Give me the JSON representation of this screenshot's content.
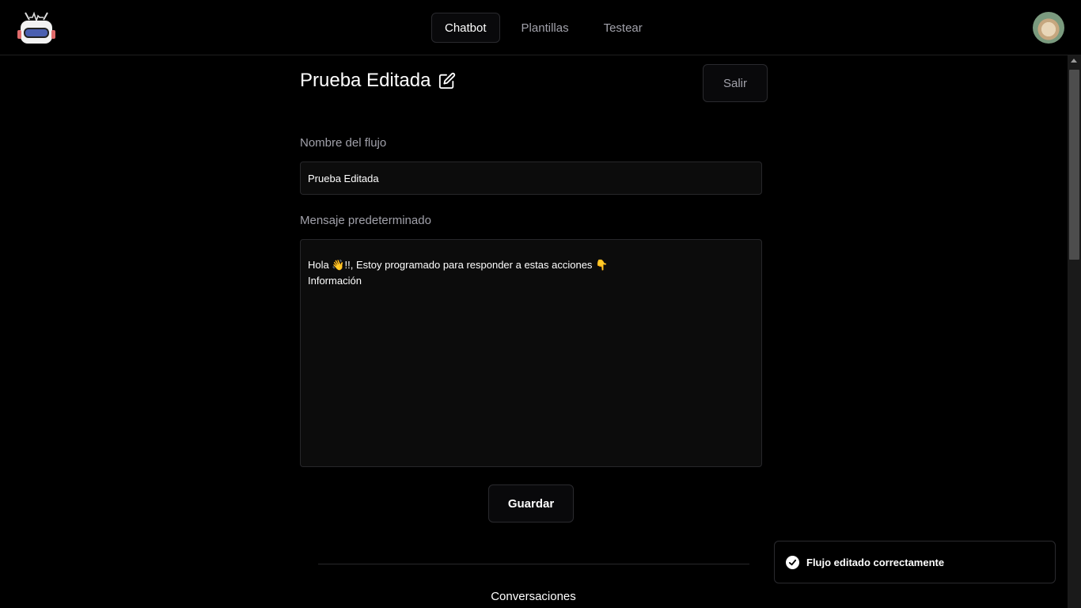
{
  "header": {
    "logo_icon": "robot-icon",
    "nav": [
      {
        "label": "Chatbot",
        "active": true
      },
      {
        "label": "Plantillas",
        "active": false
      },
      {
        "label": "Testear",
        "active": false
      }
    ],
    "avatar_icon": "user-avatar"
  },
  "flow": {
    "title": "Prueba Editada",
    "edit_icon": "pencil-square-icon",
    "exit_label": "Salir",
    "name_label": "Nombre del flujo",
    "name_value": "Prueba Editada",
    "message_label": "Mensaje predeterminado",
    "message_value": "Hola 👋!!, Estoy programado para responder a estas acciones 👇\nInformación",
    "save_label": "Guardar",
    "conversations_label": "Conversaciones"
  },
  "toast": {
    "icon": "check-circle-icon",
    "message": "Flujo editado correctamente"
  },
  "colors": {
    "background": "#000000",
    "panel": "#0c0c0c",
    "border": "#27272a",
    "muted_text": "#a1a1aa"
  }
}
